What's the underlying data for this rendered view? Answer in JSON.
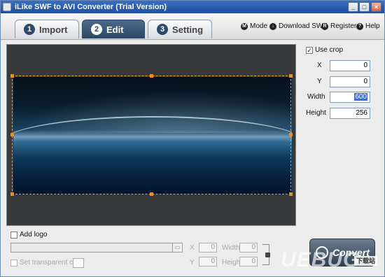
{
  "window": {
    "title": "iLike SWF to AVI Converter (Trial Version)"
  },
  "tabs": [
    {
      "num": "1",
      "label": "Import"
    },
    {
      "num": "2",
      "label": "Edit"
    },
    {
      "num": "3",
      "label": "Setting"
    }
  ],
  "toplinks": {
    "mode": "Mode",
    "download": "Download SWF",
    "register": "Register",
    "help": "Help"
  },
  "crop": {
    "use_crop_label": "Use crop",
    "use_crop_checked": true,
    "x_label": "X",
    "x_value": "0",
    "y_label": "Y",
    "y_value": "0",
    "width_label": "Width",
    "width_value": "600",
    "height_label": "Height",
    "height_value": "256"
  },
  "logo": {
    "add_logo_label": "Add logo",
    "path_value": "",
    "transparent_label": "Set transparent color",
    "x_label": "X",
    "x_value": "0",
    "y_label": "Y",
    "y_value": "0",
    "width_label": "Width",
    "width_value": "0",
    "height_label": "Height",
    "height_value": "0"
  },
  "convert_label": "Convert",
  "watermark": {
    "text": "UEBUG",
    "badge": "下载站"
  },
  "colors": {
    "accent": "#2c4663",
    "crop_border": "#f0a030",
    "titlebar": "#2a5aa8"
  }
}
